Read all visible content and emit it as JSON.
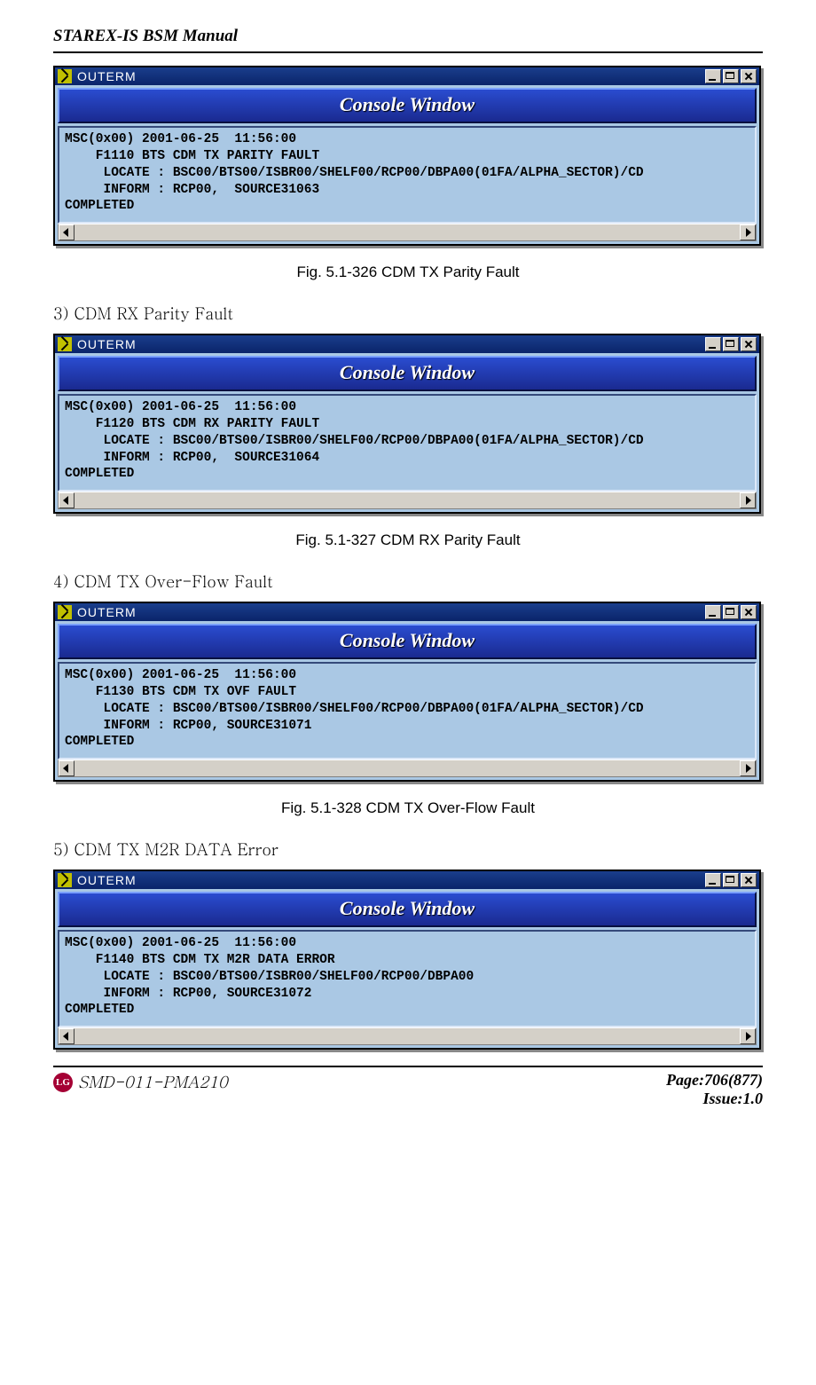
{
  "header": {
    "manual": "STAREX-IS BSM Manual"
  },
  "footer": {
    "code": "SMD-011-PMA210",
    "page": "Page:706(877)",
    "issue": "Issue:1.0",
    "logo": "LG"
  },
  "items": {
    "i3": "3)  CDM RX Parity Fault",
    "i4": "4)  CDM TX Over-Flow Fault",
    "i5": "5)  CDM TX M2R DATA Error"
  },
  "captions": {
    "c1": "Fig.    5.1-326 CDM TX Parity Fault",
    "c2": "Fig.    5.1-327 CDM RX Parity Fault",
    "c3": "Fig.    5.1-328 CDM TX Over-Flow Fault"
  },
  "window": {
    "title": "OUTERM",
    "banner": "Console Window"
  },
  "consoles": {
    "w1": "MSC(0x00) 2001-06-25  11:56:00\n    F1110 BTS CDM TX PARITY FAULT\n     LOCATE : BSC00/BTS00/ISBR00/SHELF00/RCP00/DBPA00(01FA/ALPHA_SECTOR)/CD\n     INFORM : RCP00,  SOURCE31063\nCOMPLETED\n",
    "w2": "MSC(0x00) 2001-06-25  11:56:00\n    F1120 BTS CDM RX PARITY FAULT\n     LOCATE : BSC00/BTS00/ISBR00/SHELF00/RCP00/DBPA00(01FA/ALPHA_SECTOR)/CD\n     INFORM : RCP00,  SOURCE31064\nCOMPLETED\n",
    "w3": "MSC(0x00) 2001-06-25  11:56:00\n    F1130 BTS CDM TX OVF FAULT\n     LOCATE : BSC00/BTS00/ISBR00/SHELF00/RCP00/DBPA00(01FA/ALPHA_SECTOR)/CD\n     INFORM : RCP00, SOURCE31071\nCOMPLETED\n",
    "w4": "MSC(0x00) 2001-06-25  11:56:00\n    F1140 BTS CDM TX M2R DATA ERROR\n     LOCATE : BSC00/BTS00/ISBR00/SHELF00/RCP00/DBPA00\n     INFORM : RCP00, SOURCE31072\nCOMPLETED\n"
  }
}
